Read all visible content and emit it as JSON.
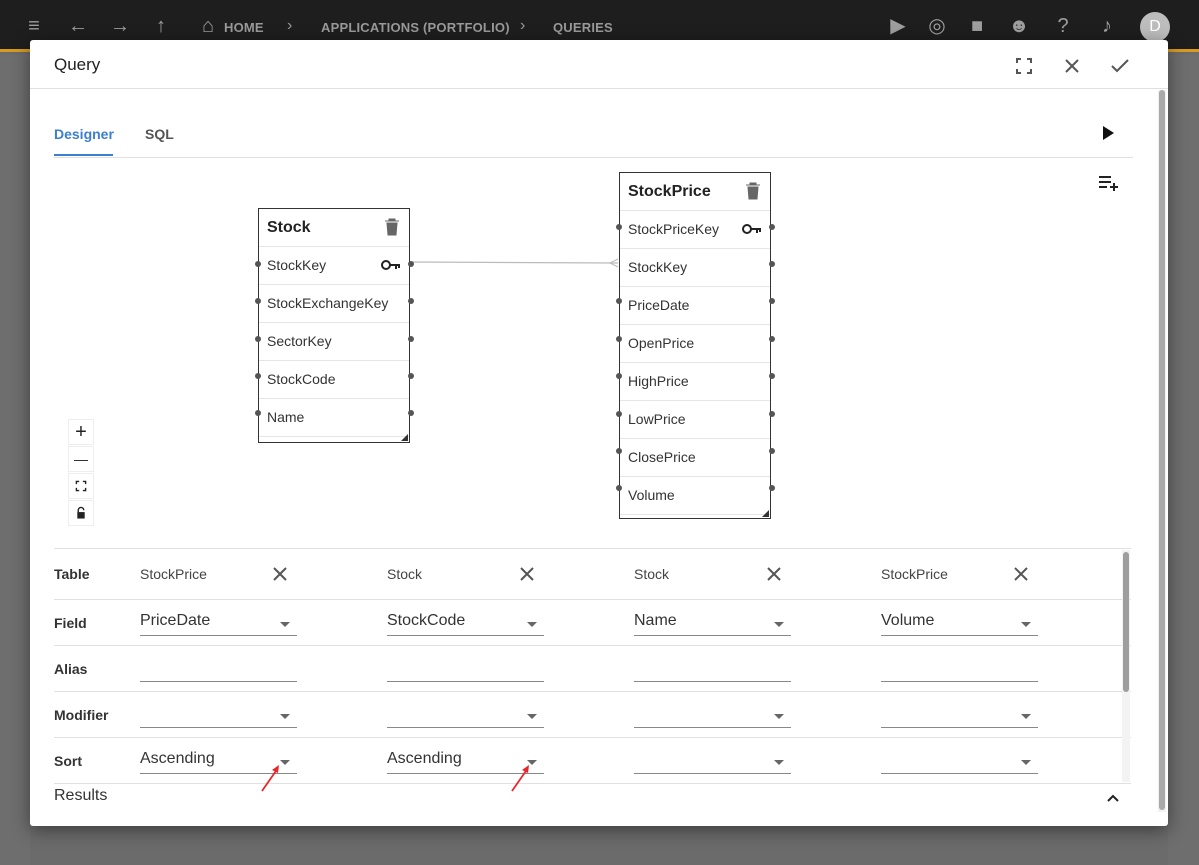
{
  "appbar": {
    "breadcrumbs": [
      "HOME",
      "APPLICATIONS (PORTFOLIO)",
      "QUERIES"
    ],
    "avatar_initial": "D"
  },
  "dialog": {
    "title": "Query",
    "tabs": [
      {
        "label": "Designer",
        "active": true
      },
      {
        "label": "SQL",
        "active": false
      }
    ]
  },
  "tables": [
    {
      "title": "Stock",
      "fields": [
        "StockKey",
        "StockExchangeKey",
        "SectorKey",
        "StockCode",
        "Name"
      ],
      "key_field": "StockKey"
    },
    {
      "title": "StockPrice",
      "fields": [
        "StockPriceKey",
        "StockKey",
        "PriceDate",
        "OpenPrice",
        "HighPrice",
        "LowPrice",
        "ClosePrice",
        "Volume"
      ],
      "key_field": "StockPriceKey"
    }
  ],
  "zoom_controls": [
    "+",
    "—"
  ],
  "grid": {
    "row_labels": [
      "Table",
      "Field",
      "Alias",
      "Modifier",
      "Sort"
    ],
    "columns": [
      {
        "table": "StockPrice",
        "field": "PriceDate",
        "alias": "",
        "modifier": "",
        "sort": "Ascending"
      },
      {
        "table": "Stock",
        "field": "StockCode",
        "alias": "",
        "modifier": "",
        "sort": "Ascending"
      },
      {
        "table": "Stock",
        "field": "Name",
        "alias": "",
        "modifier": "",
        "sort": ""
      },
      {
        "table": "StockPrice",
        "field": "Volume",
        "alias": "",
        "modifier": "",
        "sort": ""
      }
    ]
  },
  "results_label": "Results",
  "colors": {
    "accent": "#3c7fcf",
    "annotation_arrow": "#e8262d",
    "appbar_stripe": "#d89b1f"
  }
}
